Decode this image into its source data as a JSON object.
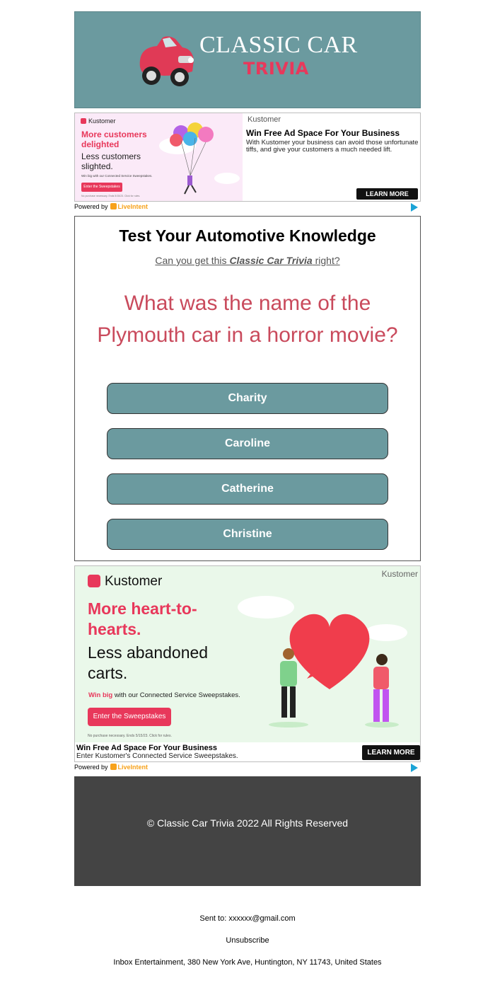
{
  "header": {
    "title_line1": "CLASSIC CAR",
    "title_line2": "TRIVIA"
  },
  "ad_top": {
    "brand": "Kustomer",
    "headline": "More customers delighted",
    "subline": "Less customers slighted.",
    "win_text": "Win big with our Connected Service Sweepstakes.",
    "enter_button": "Enter the Sweepstakes",
    "fine_print": "No purchase necessary. Ends 5/15/23. Click for rules.",
    "sponsor": "Kustomer",
    "title": "Win Free Ad Space For Your Business",
    "body": "With Kustomer your business can avoid those unfortunate tiffs, and give your customers a much needed lift.",
    "cta": "LEARN MORE"
  },
  "powered_by": {
    "label": "Powered by",
    "brand": "LiveIntent"
  },
  "quiz": {
    "heading": "Test Your Automotive Knowledge",
    "sub_prefix": "Can you get this ",
    "sub_emphasis": "Classic Car Trivia",
    "sub_suffix": " right?",
    "question": "What was the name of the Plymouth car in a horror movie?",
    "answers": [
      "Charity",
      "Caroline",
      "Catherine",
      "Christine"
    ]
  },
  "ad_bottom": {
    "sponsor": "Kustomer",
    "brand": "Kustomer",
    "headline": "More heart-to-hearts.",
    "subline": "Less abandoned carts.",
    "win_bold": "Win big",
    "win_rest": " with our Connected Service Sweepstakes.",
    "enter_button": "Enter the Sweepstakes",
    "fine_print": "No purchase necessary. Ends 5/15/23. Click for rules.",
    "title": "Win Free Ad Space For Your Business",
    "body": "Enter Kustomer's Connected Service Sweepstakes.",
    "cta": "LEARN MORE"
  },
  "footer": {
    "copyright": "© Classic Car Trivia 2022 All Rights Reserved"
  },
  "email_footer": {
    "sent_to": "Sent to: xxxxxx@gmail.com",
    "unsubscribe": "Unsubscribe",
    "address": "Inbox Entertainment, 380 New York Ave, Huntington, NY 11743, United States"
  },
  "colors": {
    "header_bg": "#6b9a9f",
    "accent_red": "#e8385b",
    "question_red": "#c94a5c",
    "footer_bg": "#444444"
  }
}
